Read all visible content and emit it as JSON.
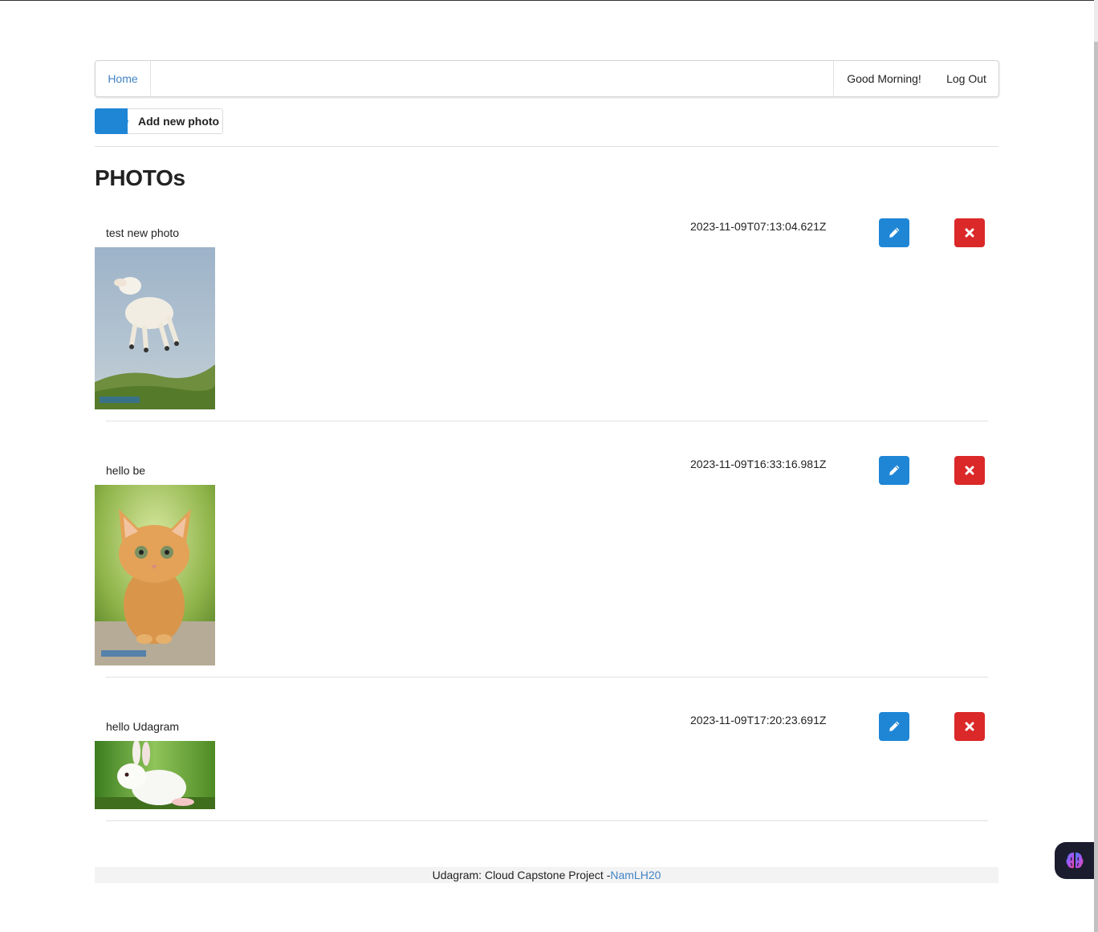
{
  "nav": {
    "home": "Home",
    "greeting": "Good Morning!",
    "logout": "Log Out"
  },
  "toolbar": {
    "add_photo": "Add new photo"
  },
  "page": {
    "title": "PHOTOs"
  },
  "photos": [
    {
      "caption": "test new photo",
      "date": "2023-11-09T07:13:04.621Z",
      "image": "lamb"
    },
    {
      "caption": "hello be",
      "date": "2023-11-09T16:33:16.981Z",
      "image": "kitten"
    },
    {
      "caption": "hello Udagram",
      "date": "2023-11-09T17:20:23.691Z",
      "image": "rabbit"
    }
  ],
  "footer": {
    "text": "Udagram: Cloud Capstone Project -",
    "author": "NamLH20"
  },
  "icons": {
    "edit": "pencil-icon",
    "delete": "close-icon",
    "widget": "brain-icon"
  },
  "colors": {
    "primary": "#1f86d6",
    "danger": "#db2828",
    "link": "#4183c4"
  }
}
